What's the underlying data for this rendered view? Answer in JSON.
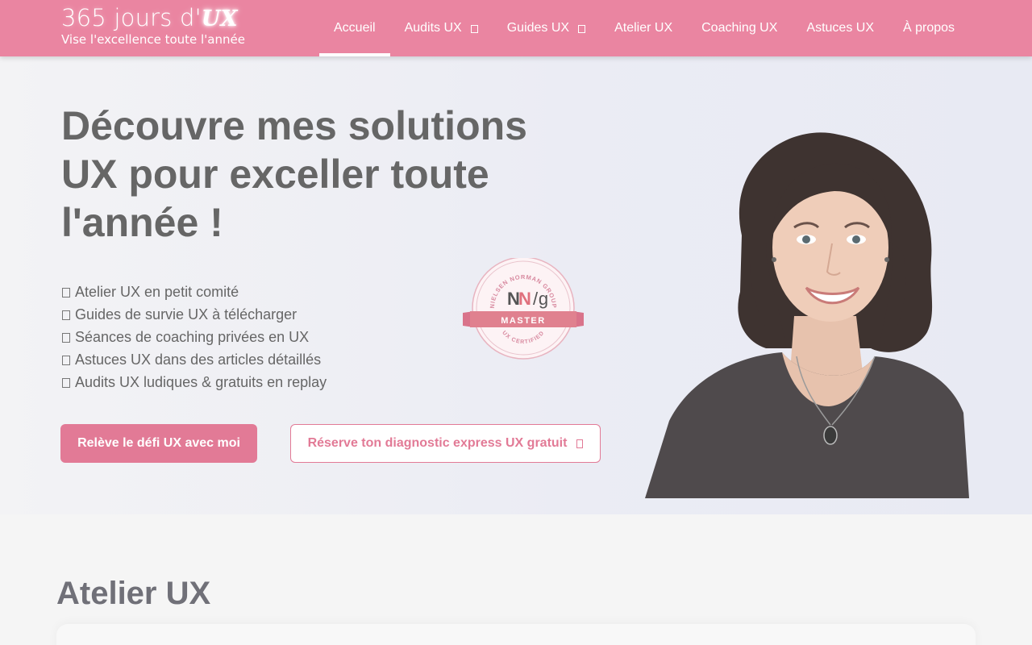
{
  "header": {
    "logo_prefix": "365 jours d'",
    "logo_ux": "UX",
    "tagline": "Vise l'excellence toute l'année"
  },
  "nav": {
    "items": [
      {
        "label": "Accueil"
      },
      {
        "label": "Audits UX"
      },
      {
        "label": "Guides UX"
      },
      {
        "label": "Atelier UX"
      },
      {
        "label": "Coaching UX"
      },
      {
        "label": "Astuces UX"
      },
      {
        "label": "À propos"
      }
    ]
  },
  "hero": {
    "title_line1": "Découvre mes solutions",
    "title_line2": "UX pour exceller toute",
    "title_line3": "l'année !",
    "features": [
      "Atelier UX en petit comité",
      "Guides de survie UX à télécharger",
      "Séances de coaching privées en UX",
      "Astuces UX dans des articles détaillés",
      "Audits UX ludiques & gratuits en replay"
    ],
    "primary_cta": "Relève le défi UX avec moi",
    "secondary_cta": "Réserve ton diagnostic express UX gratuit"
  },
  "badge": {
    "arc_top": "NIELSEN NORMAN GROUP",
    "logo_n1": "N",
    "logo_n2": "N",
    "logo_slash": "/",
    "logo_g": "g",
    "ribbon": "MASTER",
    "arc_bottom": "UX CERTIFIED"
  },
  "section": {
    "title": "Atelier UX"
  },
  "colors": {
    "brand_pink": "#ea85a1",
    "button_pink": "#e27a96",
    "heading_gray": "#666666"
  }
}
